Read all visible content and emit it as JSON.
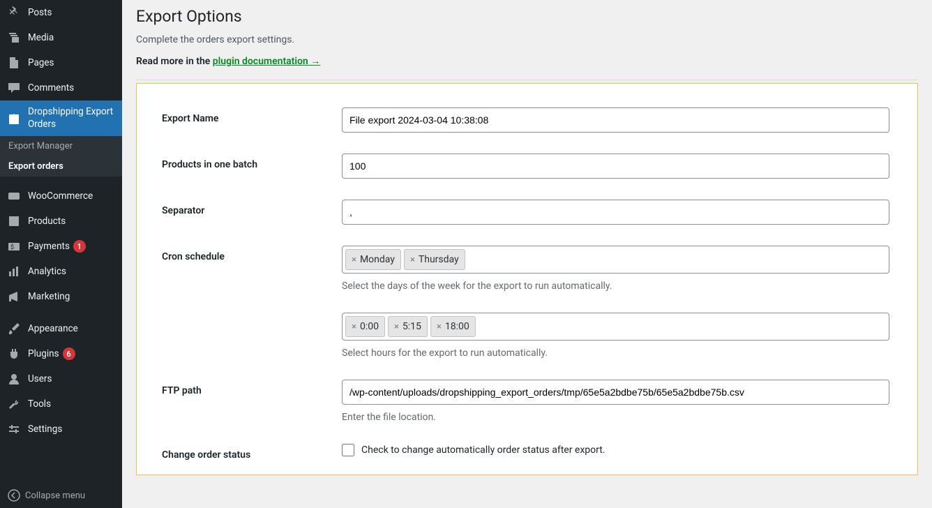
{
  "sidebar": {
    "items": [
      {
        "label": "Posts"
      },
      {
        "label": "Media"
      },
      {
        "label": "Pages"
      },
      {
        "label": "Comments"
      },
      {
        "label": "Dropshipping Export Orders"
      },
      {
        "label": "WooCommerce"
      },
      {
        "label": "Products"
      },
      {
        "label": "Payments",
        "badge": "1"
      },
      {
        "label": "Analytics"
      },
      {
        "label": "Marketing"
      },
      {
        "label": "Appearance"
      },
      {
        "label": "Plugins",
        "badge": "6"
      },
      {
        "label": "Users"
      },
      {
        "label": "Tools"
      },
      {
        "label": "Settings"
      }
    ],
    "submenu": [
      {
        "label": "Export Manager"
      },
      {
        "label": "Export orders"
      }
    ],
    "collapse": "Collapse menu"
  },
  "header": {
    "title": "Export Options",
    "subtitle": "Complete the orders export settings.",
    "docline_pre": "Read more in the ",
    "docline_link": "plugin documentation →"
  },
  "form": {
    "export_name": {
      "label": "Export Name",
      "value": "File export 2024-03-04 10:38:08"
    },
    "batch": {
      "label": "Products in one batch",
      "value": "100"
    },
    "separator": {
      "label": "Separator",
      "value": ","
    },
    "cron": {
      "label": "Cron schedule",
      "days": [
        "Monday",
        "Thursday"
      ],
      "days_help": "Select the days of the week for the export to run automatically.",
      "hours": [
        "0:00",
        "5:15",
        "18:00"
      ],
      "hours_help": "Select hours for the export to run automatically."
    },
    "ftp": {
      "label": "FTP path",
      "value": "/wp-content/uploads/dropshipping_export_orders/tmp/65e5a2bdbe75b/65e5a2bdbe75b.csv",
      "help": "Enter the file location."
    },
    "changestatus": {
      "label": "Change order status",
      "check_label": "Check to change automatically order status after export."
    }
  }
}
